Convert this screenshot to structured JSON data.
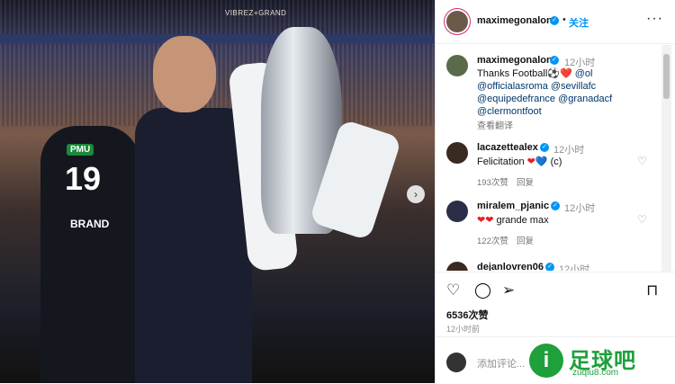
{
  "post": {
    "username": "maximegonalons",
    "follow_label": "关注",
    "more_label": "···",
    "photo": {
      "banner_text": "VIBREZ+GRAND",
      "jersey_number": "19",
      "jersey_name": "BRAND",
      "sponsor": "PMU"
    }
  },
  "caption": {
    "username": "maximegonalons",
    "time": "12小时",
    "text_start": "Thanks Football",
    "emojis": "⚽❤️",
    "mentions": [
      "@ol",
      "@officialasroma",
      "@sevillafc",
      "@equipedefrance",
      "@granadacf",
      "@clermontfoot"
    ],
    "translate_label": "查看翻译"
  },
  "comments": [
    {
      "username": "lacazettealex",
      "time": "12小时",
      "text": "Felicitation",
      "emojis": "❤💙",
      "suffix": "(c)",
      "likes": "193次赞",
      "reply": "回复"
    },
    {
      "username": "miralem_pjanic",
      "time": "12小时",
      "text": "grande max",
      "emojis": "❤❤",
      "likes": "122次赞",
      "reply": "回复"
    },
    {
      "username": "dejanlovren06",
      "time": "12小时"
    }
  ],
  "actions": {
    "likes": "6536次赞",
    "posted": "12小时前"
  },
  "composer": {
    "placeholder": "添加评论..."
  },
  "watermark": {
    "mark": "i",
    "title": "足球吧",
    "url": "zuqiu8.com"
  },
  "colors": {
    "accent_blue": "#0095f6",
    "heart_red": "#ed1c24",
    "watermark_green": "#1ea03a"
  }
}
